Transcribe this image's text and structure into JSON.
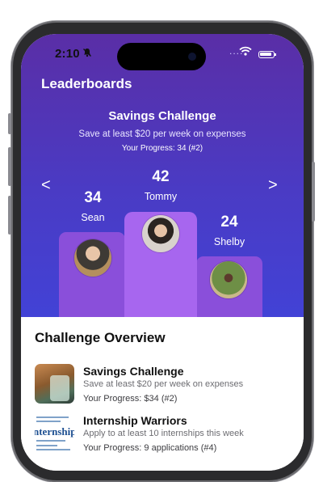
{
  "status": {
    "time": "2:10",
    "bell_icon": "bell-slash-icon",
    "signal": "....",
    "wifi_icon": "wifi-icon",
    "battery_icon": "battery-icon"
  },
  "header": {
    "title": "Leaderboards"
  },
  "challenge": {
    "title": "Savings Challenge",
    "description": "Save at least $20 per week on expenses",
    "progress": "Your Progress: 34 (#2)"
  },
  "nav": {
    "prev": "<",
    "next": ">"
  },
  "podium": [
    {
      "rank": 2,
      "score": "34",
      "name": "Sean"
    },
    {
      "rank": 1,
      "score": "42",
      "name": "Tommy"
    },
    {
      "rank": 3,
      "score": "24",
      "name": "Shelby"
    }
  ],
  "overview": {
    "title": "Challenge Overview",
    "items": [
      {
        "title": "Savings Challenge",
        "description": "Save at least $20 per week on expenses",
        "progress": "Your Progress: $34 (#2)"
      },
      {
        "title": "Internship Warriors",
        "description": "Apply to at least 10 internships this week",
        "progress": "Your Progress: 9 applications (#4)",
        "thumb_text": "nternship"
      }
    ]
  },
  "colors": {
    "hero_top": "#5a2ea6",
    "hero_bottom": "#4242d6",
    "podium_side": "#8a4fda",
    "podium_center": "#a766ef"
  }
}
